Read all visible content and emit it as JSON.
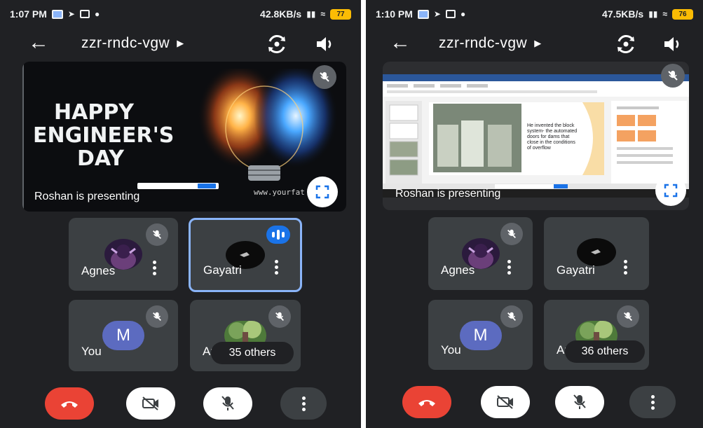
{
  "screens": [
    {
      "status": {
        "time": "1:07 PM",
        "speed": "42.8KB/s",
        "battery": "77"
      },
      "meeting_code": "zzr-rndc-vgw",
      "presentation": {
        "slide_title_lines": [
          "HAPPY",
          "ENGINEER'S",
          "DAY"
        ],
        "slide_url": "www.yourfat",
        "presenting_label": "Roshan is presenting"
      },
      "participants": {
        "agnes": "Agnes",
        "gayatri": "Gayatri",
        "you": "You",
        "you_initial": "M",
        "others_name_stub": "An",
        "others_count": "35 others"
      }
    },
    {
      "status": {
        "time": "1:10 PM",
        "speed": "47.5KB/s",
        "battery": "76"
      },
      "meeting_code": "zzr-rndc-vgw",
      "presentation": {
        "slide_text": "He invented the block system- the automated doors for dams that close in the conditions of overflow",
        "presenting_label": "Roshan is presenting"
      },
      "participants": {
        "agnes": "Agnes",
        "gayatri": "Gayatri",
        "you": "You",
        "you_initial": "M",
        "others_name_stub": "An",
        "others_count": "36 others"
      }
    }
  ],
  "icons": {
    "back": "arrow-left-icon",
    "meeting_info": "caret-right-icon",
    "switch_camera": "camera-switch-icon",
    "speaker": "speaker-icon",
    "mic_off": "mic-off-icon",
    "fullscreen": "fullscreen-icon",
    "more": "more-vert-icon",
    "end_call": "phone-hangup-icon",
    "video_off": "video-off-icon",
    "speaking": "audio-level-icon"
  },
  "colors": {
    "background": "#202124",
    "tile": "#3c4043",
    "end_call": "#ea4335",
    "speaking_border": "#8ab4f8",
    "speaking_badge": "#1a73e8",
    "battery": "#fbbc04"
  }
}
